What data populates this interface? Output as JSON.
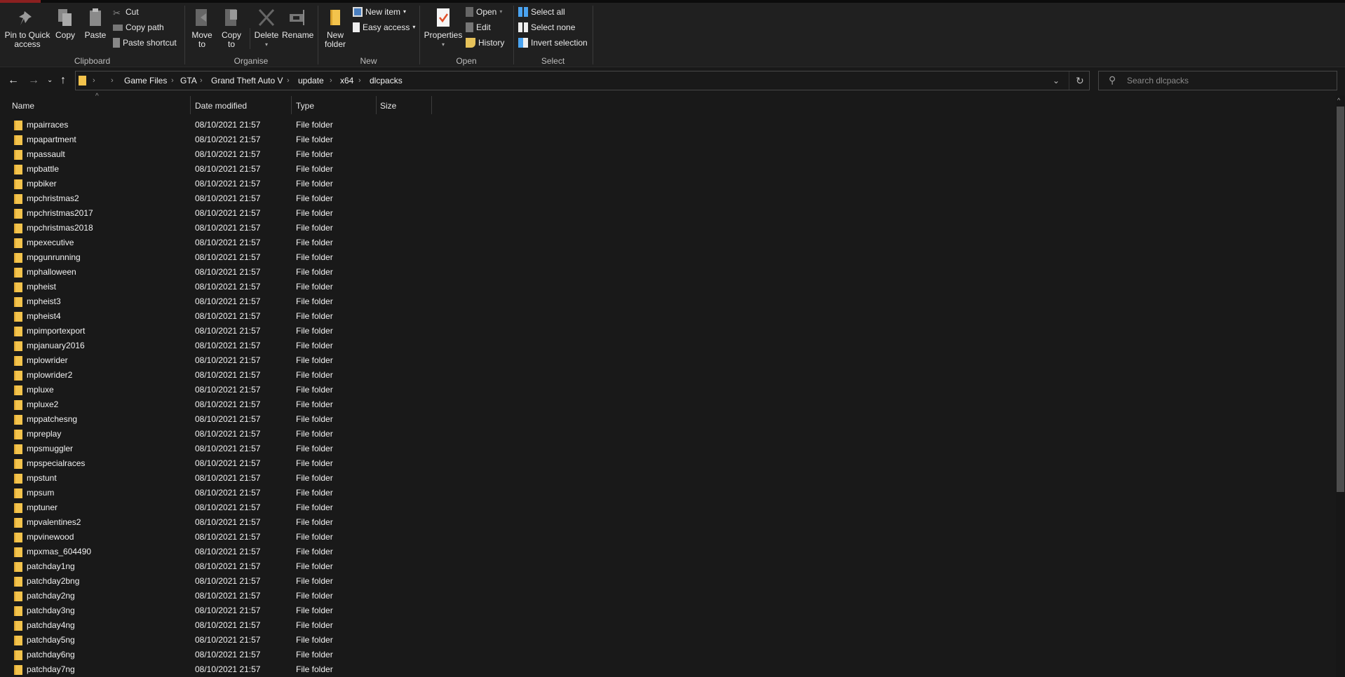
{
  "ribbon": {
    "clipboard": {
      "label": "Clipboard",
      "pin": "Pin to Quick access",
      "pin_l1": "Pin to Quick",
      "pin_l2": "access",
      "copy": "Copy",
      "paste": "Paste",
      "cut": "Cut",
      "copy_path": "Copy path",
      "paste_shortcut": "Paste shortcut"
    },
    "organise": {
      "label": "Organise",
      "move_l1": "Move",
      "move_l2": "to",
      "copy_l1": "Copy",
      "copy_l2": "to",
      "delete": "Delete",
      "rename": "Rename"
    },
    "new": {
      "label": "New",
      "new_folder_l1": "New",
      "new_folder_l2": "folder",
      "new_item": "New item",
      "easy_access": "Easy access"
    },
    "open": {
      "label": "Open",
      "properties": "Properties",
      "open": "Open",
      "edit": "Edit",
      "history": "History"
    },
    "select": {
      "label": "Select",
      "select_all": "Select all",
      "select_none": "Select none",
      "invert": "Invert selection"
    }
  },
  "address": {
    "crumbs": [
      "Game Files",
      "GTA",
      "Grand Theft Auto V",
      "update",
      "x64",
      "dlcpacks"
    ]
  },
  "search": {
    "placeholder": "Search dlcpacks"
  },
  "columns": {
    "name": "Name",
    "date": "Date modified",
    "type": "Type",
    "size": "Size"
  },
  "files": [
    {
      "name": "mpairraces",
      "date": "08/10/2021 21:57",
      "type": "File folder"
    },
    {
      "name": "mpapartment",
      "date": "08/10/2021 21:57",
      "type": "File folder"
    },
    {
      "name": "mpassault",
      "date": "08/10/2021 21:57",
      "type": "File folder"
    },
    {
      "name": "mpbattle",
      "date": "08/10/2021 21:57",
      "type": "File folder"
    },
    {
      "name": "mpbiker",
      "date": "08/10/2021 21:57",
      "type": "File folder"
    },
    {
      "name": "mpchristmas2",
      "date": "08/10/2021 21:57",
      "type": "File folder"
    },
    {
      "name": "mpchristmas2017",
      "date": "08/10/2021 21:57",
      "type": "File folder"
    },
    {
      "name": "mpchristmas2018",
      "date": "08/10/2021 21:57",
      "type": "File folder"
    },
    {
      "name": "mpexecutive",
      "date": "08/10/2021 21:57",
      "type": "File folder"
    },
    {
      "name": "mpgunrunning",
      "date": "08/10/2021 21:57",
      "type": "File folder"
    },
    {
      "name": "mphalloween",
      "date": "08/10/2021 21:57",
      "type": "File folder"
    },
    {
      "name": "mpheist",
      "date": "08/10/2021 21:57",
      "type": "File folder"
    },
    {
      "name": "mpheist3",
      "date": "08/10/2021 21:57",
      "type": "File folder"
    },
    {
      "name": "mpheist4",
      "date": "08/10/2021 21:57",
      "type": "File folder"
    },
    {
      "name": "mpimportexport",
      "date": "08/10/2021 21:57",
      "type": "File folder"
    },
    {
      "name": "mpjanuary2016",
      "date": "08/10/2021 21:57",
      "type": "File folder"
    },
    {
      "name": "mplowrider",
      "date": "08/10/2021 21:57",
      "type": "File folder"
    },
    {
      "name": "mplowrider2",
      "date": "08/10/2021 21:57",
      "type": "File folder"
    },
    {
      "name": "mpluxe",
      "date": "08/10/2021 21:57",
      "type": "File folder"
    },
    {
      "name": "mpluxe2",
      "date": "08/10/2021 21:57",
      "type": "File folder"
    },
    {
      "name": "mppatchesng",
      "date": "08/10/2021 21:57",
      "type": "File folder"
    },
    {
      "name": "mpreplay",
      "date": "08/10/2021 21:57",
      "type": "File folder"
    },
    {
      "name": "mpsmuggler",
      "date": "08/10/2021 21:57",
      "type": "File folder"
    },
    {
      "name": "mpspecialraces",
      "date": "08/10/2021 21:57",
      "type": "File folder"
    },
    {
      "name": "mpstunt",
      "date": "08/10/2021 21:57",
      "type": "File folder"
    },
    {
      "name": "mpsum",
      "date": "08/10/2021 21:57",
      "type": "File folder"
    },
    {
      "name": "mptuner",
      "date": "08/10/2021 21:57",
      "type": "File folder"
    },
    {
      "name": "mpvalentines2",
      "date": "08/10/2021 21:57",
      "type": "File folder"
    },
    {
      "name": "mpvinewood",
      "date": "08/10/2021 21:57",
      "type": "File folder"
    },
    {
      "name": "mpxmas_604490",
      "date": "08/10/2021 21:57",
      "type": "File folder"
    },
    {
      "name": "patchday1ng",
      "date": "08/10/2021 21:57",
      "type": "File folder"
    },
    {
      "name": "patchday2bng",
      "date": "08/10/2021 21:57",
      "type": "File folder"
    },
    {
      "name": "patchday2ng",
      "date": "08/10/2021 21:57",
      "type": "File folder"
    },
    {
      "name": "patchday3ng",
      "date": "08/10/2021 21:57",
      "type": "File folder"
    },
    {
      "name": "patchday4ng",
      "date": "08/10/2021 21:57",
      "type": "File folder"
    },
    {
      "name": "patchday5ng",
      "date": "08/10/2021 21:57",
      "type": "File folder"
    },
    {
      "name": "patchday6ng",
      "date": "08/10/2021 21:57",
      "type": "File folder"
    },
    {
      "name": "patchday7ng",
      "date": "08/10/2021 21:57",
      "type": "File folder"
    }
  ]
}
